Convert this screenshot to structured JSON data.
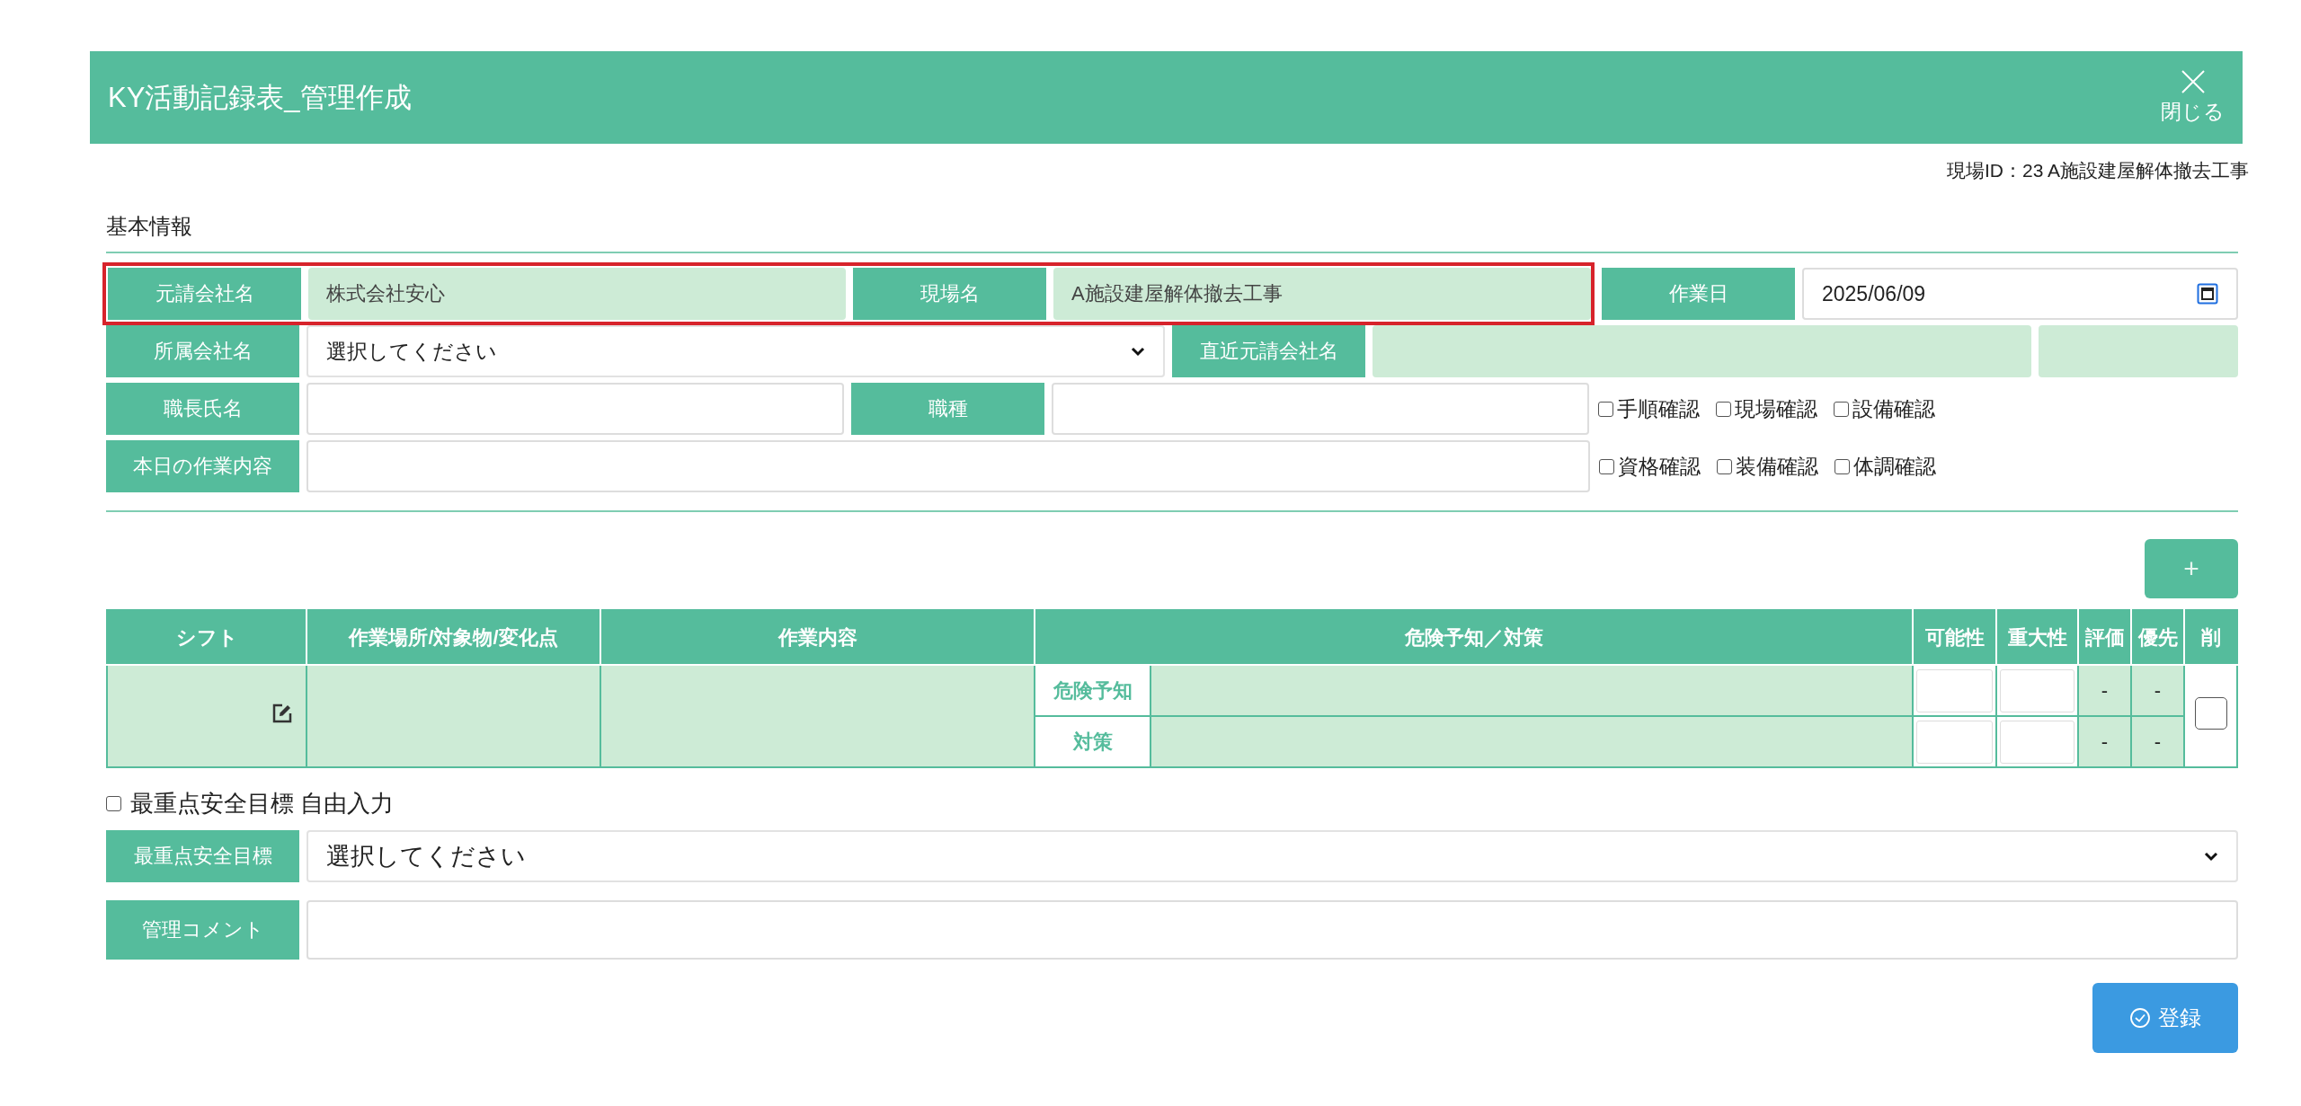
{
  "header": {
    "title": "KY活動記録表_管理作成",
    "close_label": "閉じる"
  },
  "site_id": "現場ID：23 A施設建屋解体撤去工事",
  "basic_info": {
    "title": "基本情報",
    "highlight": {
      "highlighted": true,
      "fields": [
        {
          "label": "元請会社名",
          "value": "株式会社安心"
        },
        {
          "label": "現場名",
          "value": "A施設建屋解体撤去工事"
        }
      ]
    },
    "work_date": {
      "label": "作業日",
      "value": "2025/06/09"
    },
    "affiliation": {
      "label": "所属会社名",
      "value": "選択してください"
    },
    "recent_contractor": {
      "label": "直近元請会社名"
    },
    "foreman": {
      "label": "職長氏名"
    },
    "trade": {
      "label": "職種"
    },
    "todays_work": {
      "label": "本日の作業内容"
    },
    "checks": [
      [
        {
          "label": "手順確認",
          "checked": false
        },
        {
          "label": "現場確認",
          "checked": false
        },
        {
          "label": "設備確認",
          "checked": false
        }
      ],
      [
        {
          "label": "資格確認",
          "checked": false
        },
        {
          "label": "装備確認",
          "checked": false
        },
        {
          "label": "体調確認",
          "checked": false
        }
      ]
    ]
  },
  "add_button": "+",
  "table": {
    "columns": [
      "シフト",
      "作業場所/対象物/変化点",
      "作業内容",
      "危険予知／対策",
      "可能性",
      "重大性",
      "評価",
      "優先",
      "削"
    ],
    "sub_rows": [
      {
        "label": "危険予知",
        "evaluation": "-",
        "priority": "-"
      },
      {
        "label": "対策",
        "evaluation": "-",
        "priority": "-"
      }
    ],
    "delete_checked": false
  },
  "free_input": {
    "label": "最重点安全目標 自由入力",
    "checked": false
  },
  "safety_goal": {
    "label": "最重点安全目標",
    "value": "選択してください"
  },
  "comment": {
    "label": "管理コメント"
  },
  "register": {
    "label": "登録"
  }
}
